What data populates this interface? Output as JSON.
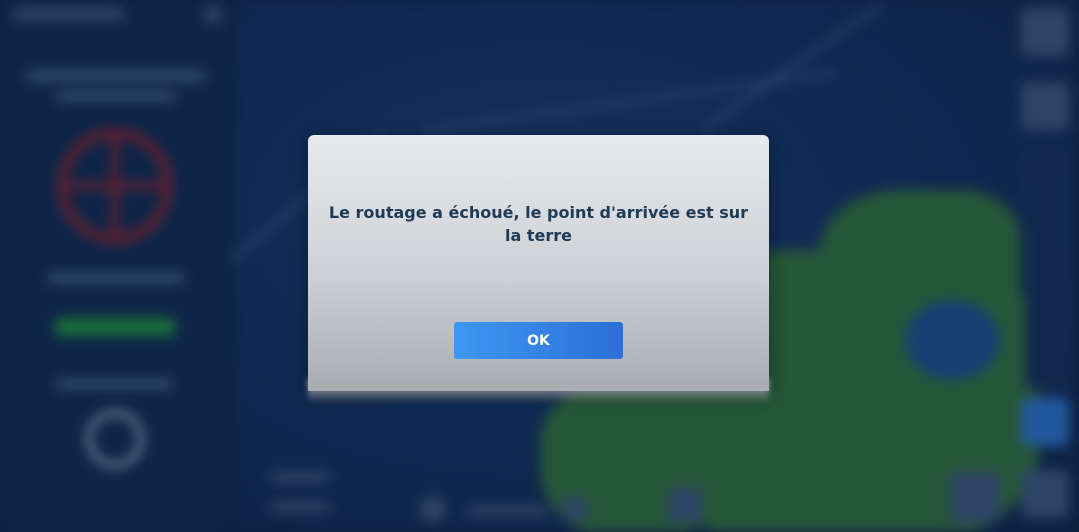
{
  "dialog": {
    "message": "Le routage a échoué, le point d'arrivée est sur la terre",
    "ok_label": "OK"
  },
  "colors": {
    "map_background": "#12305c",
    "modal_text": "#1e3a55",
    "ok_button_start": "#3d98f5",
    "ok_button_end": "#2c6fd6",
    "land": "#2e6b3a",
    "target_icon": "#7a2330",
    "status_bar": "#1f8a3c"
  },
  "icons": {
    "target": "crosshair-target-icon",
    "close": "close-icon"
  }
}
